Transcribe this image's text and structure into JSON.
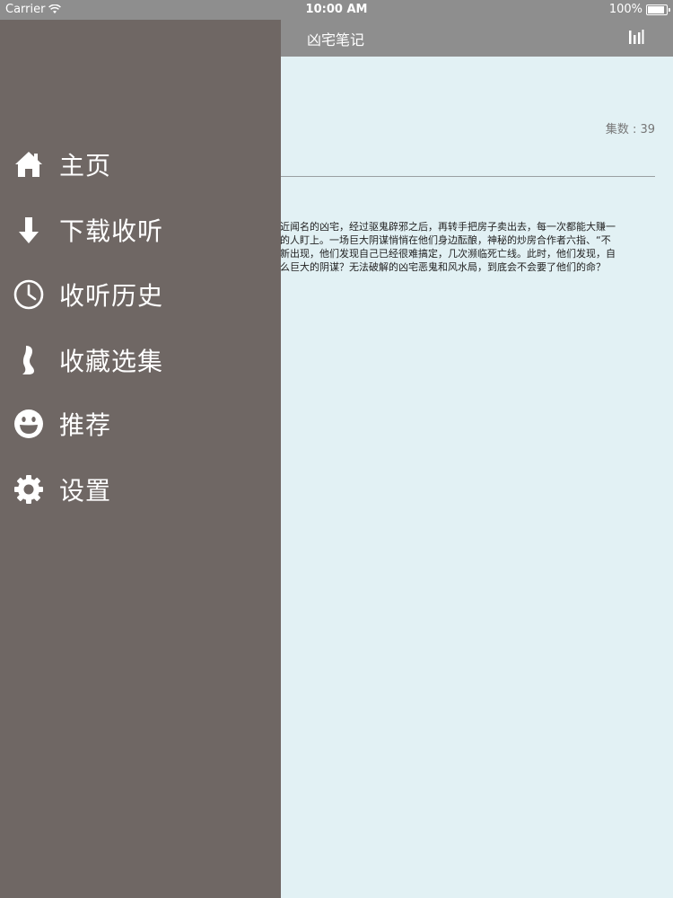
{
  "status_bar": {
    "carrier": "Carrier",
    "time": "10:00 AM",
    "battery": "100%",
    "battery_level": 1.0
  },
  "nav_bar": {
    "title": "凶宅笔记",
    "chart_icon": "bar-chart-icon"
  },
  "main": {
    "episode_count": "集数 : 39",
    "description_lines": [
      "近闻名的凶宅，经过驱鬼辟邪之后，再转手把房子卖出去，每一次都能大赚一",
      "的人盯上。一场巨大阴谋悄悄在他们身边酝酿，神秘的炒房合作者六指、“不",
      "新出现，他们发现自己已经很难搞定，几次濒临死亡线。此时，他们发现，自",
      "么巨大的阴谋？无法破解的凶宅恶鬼和风水局，到底会不会要了他们的命？"
    ]
  },
  "drawer": {
    "background_color": "#6f6764",
    "items": [
      {
        "label": "主页",
        "icon": "home-icon"
      },
      {
        "label": "下载收听",
        "icon": "download-arrow-icon"
      },
      {
        "label": "收听历史",
        "icon": "clock-icon"
      },
      {
        "label": "收藏选集",
        "icon": "ribbon-icon"
      },
      {
        "label": "推荐",
        "icon": "smiley-icon"
      },
      {
        "label": "设置",
        "icon": "gear-icon"
      }
    ]
  }
}
